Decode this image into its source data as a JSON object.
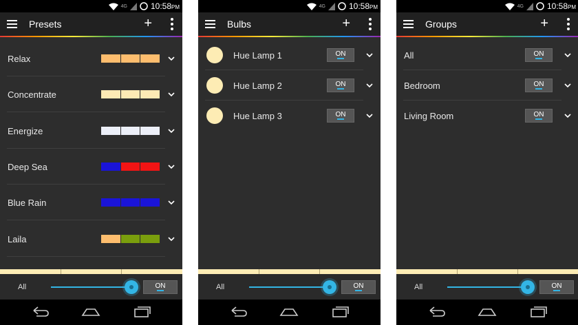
{
  "status": {
    "network": "4G",
    "time": "10:58",
    "ampm": "PM",
    "battery": "26"
  },
  "colors": {
    "accent": "#33b5e5",
    "background": "#2d2d2d",
    "appbar": "#212121",
    "bulb": "#fdecb4"
  },
  "presets_screen": {
    "title": "Presets",
    "items": [
      {
        "label": "Relax",
        "colors": [
          "#fdbd6e",
          "#fdbd6e",
          "#fdbd6e"
        ]
      },
      {
        "label": "Concentrate",
        "colors": [
          "#fdeab5",
          "#fdeab5",
          "#fdeab5"
        ]
      },
      {
        "label": "Energize",
        "colors": [
          "#eceff8",
          "#eceff8",
          "#eceff8"
        ]
      },
      {
        "label": "Deep Sea",
        "colors": [
          "#1a14d8",
          "#f21414",
          "#f21414"
        ]
      },
      {
        "label": "Blue Rain",
        "colors": [
          "#1a14d8",
          "#1a14d8",
          "#1a14d8"
        ]
      },
      {
        "label": "Laila",
        "colors": [
          "#fdbd6e",
          "#7a9e0d",
          "#7a9e0d"
        ]
      }
    ],
    "footer": {
      "all_label": "All",
      "toggle": "ON"
    }
  },
  "bulbs_screen": {
    "title": "Bulbs",
    "items": [
      {
        "label": "Hue Lamp 1",
        "toggle": "ON"
      },
      {
        "label": "Hue Lamp 2",
        "toggle": "ON"
      },
      {
        "label": "Hue Lamp 3",
        "toggle": "ON"
      }
    ],
    "footer": {
      "all_label": "All",
      "toggle": "ON"
    }
  },
  "groups_screen": {
    "title": "Groups",
    "items": [
      {
        "label": "All",
        "toggle": "ON"
      },
      {
        "label": "Bedroom",
        "toggle": "ON"
      },
      {
        "label": "Living Room",
        "toggle": "ON"
      }
    ],
    "footer": {
      "all_label": "All",
      "toggle": "ON"
    }
  }
}
